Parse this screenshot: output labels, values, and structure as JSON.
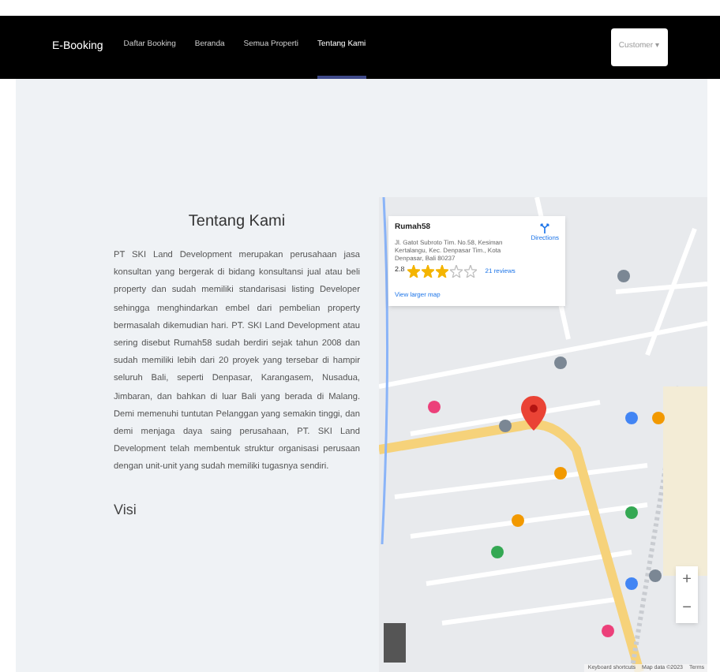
{
  "navbar": {
    "brand": "E-Booking",
    "items": [
      {
        "label": "Daftar Booking",
        "selected": false
      },
      {
        "label": "Beranda",
        "selected": false
      },
      {
        "label": "Semua Properti",
        "selected": false
      },
      {
        "label": "Tentang Kami",
        "selected": true
      }
    ],
    "user_menu": {
      "label": "Customer",
      "caret": "▾"
    }
  },
  "about": {
    "title": "Tentang Kami",
    "paragraph": "PT SKI Land Development merupakan perusahaan jasa konsultan yang bergerak di bidang konsultansi jual atau beli property dan sudah memiliki standarisasi listing Developer sehingga menghindarkan embel dari pembelian property bermasalah dikemudian hari. PT. SKI Land Development atau sering disebut Rumah58 sudah berdiri sejak tahun 2008 dan sudah memiliki lebih dari 20 proyek yang tersebar di hampir seluruh Bali, seperti Denpasar, Karangasem, Nusadua, Jimbaran, dan bahkan di luar Bali yang berada di Malang. Demi memenuhi tuntutan Pelanggan yang semakin tinggi, dan demi menjaga daya saing perusahaan, PT. SKI Land Development telah membentuk struktur organisasi perusaan dengan unit-unit yang sudah memiliki tugasnya sendiri.",
    "subtitle": "Visi"
  },
  "map": {
    "place_card": {
      "name": "Rumah58",
      "address": "Jl. Gatot Subroto Tim. No.58, Kesiman Kertalangu, Kec. Denpasar Tim., Kota Denpasar, Bali 80237",
      "rating": "2.8",
      "stars": 3,
      "reviews": "21 reviews",
      "directions": "Directions",
      "larger_map": "View larger map"
    },
    "zoom_in": "+",
    "zoom_out": "−",
    "footer": [
      "Keyboard shortcuts",
      "Map data ©2023",
      "Terms"
    ]
  }
}
